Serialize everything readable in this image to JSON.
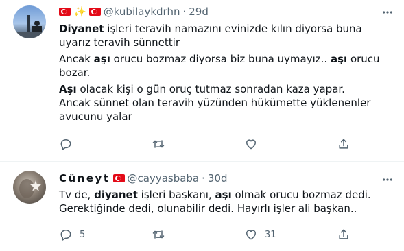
{
  "tweets": [
    {
      "display_name": "",
      "handle": "@kubilaykdrhn",
      "separator": "·",
      "time": "29d",
      "body": [
        [
          {
            "t": "Diyanet",
            "b": true
          },
          {
            "t": " işleri  teravih namazını  evinizde kılın diyorsa buna uyarız teravih sünnettir",
            "b": false
          }
        ],
        [
          {
            "t": "Ancak ",
            "b": false
          },
          {
            "t": "aşı",
            "b": true
          },
          {
            "t": " orucu bozmaz diyorsa biz buna uymayız.. ",
            "b": false
          },
          {
            "t": "aşı",
            "b": true
          },
          {
            "t": " orucu bozar.",
            "b": false
          }
        ],
        [
          {
            "t": "Aşı",
            "b": true
          },
          {
            "t": " olacak kişi o gün oruç tutmaz sonradan kaza yapar.",
            "b": false
          },
          {
            "br": true
          },
          {
            "t": "Ancak sünnet olan teravih yüzünden hükümette yüklenenler avucunu yalar",
            "b": false
          }
        ]
      ],
      "counts": {
        "reply": "",
        "retweet": "",
        "like": ""
      }
    },
    {
      "display_name": "Cüneyt",
      "handle": "@cayyasbaba",
      "separator": "·",
      "time": "30d",
      "body": [
        [
          {
            "t": "Tv de, ",
            "b": false
          },
          {
            "t": "diyanet",
            "b": true
          },
          {
            "t": " işleri başkanı, ",
            "b": false
          },
          {
            "t": "aşı",
            "b": true
          },
          {
            "t": " olmak orucu bozmaz dedi.",
            "b": false
          },
          {
            "br": true
          },
          {
            "t": "Gerektiğinde dedi, olunabilir dedi. Hayırlı işler ali başkan..",
            "b": false
          }
        ]
      ],
      "counts": {
        "reply": "5",
        "retweet": "",
        "like": "31"
      }
    }
  ],
  "icons": {
    "more": "more-dots-icon",
    "reply": "reply-icon",
    "retweet": "retweet-icon",
    "like": "heart-icon",
    "share": "share-icon",
    "flag": "turkey-flag-icon",
    "sparkles": "sparkles-icon"
  },
  "colors": {
    "text": "#0f1419",
    "secondary": "#536471",
    "flag_red": "#e30a17",
    "sparkle": "#f5b301"
  }
}
